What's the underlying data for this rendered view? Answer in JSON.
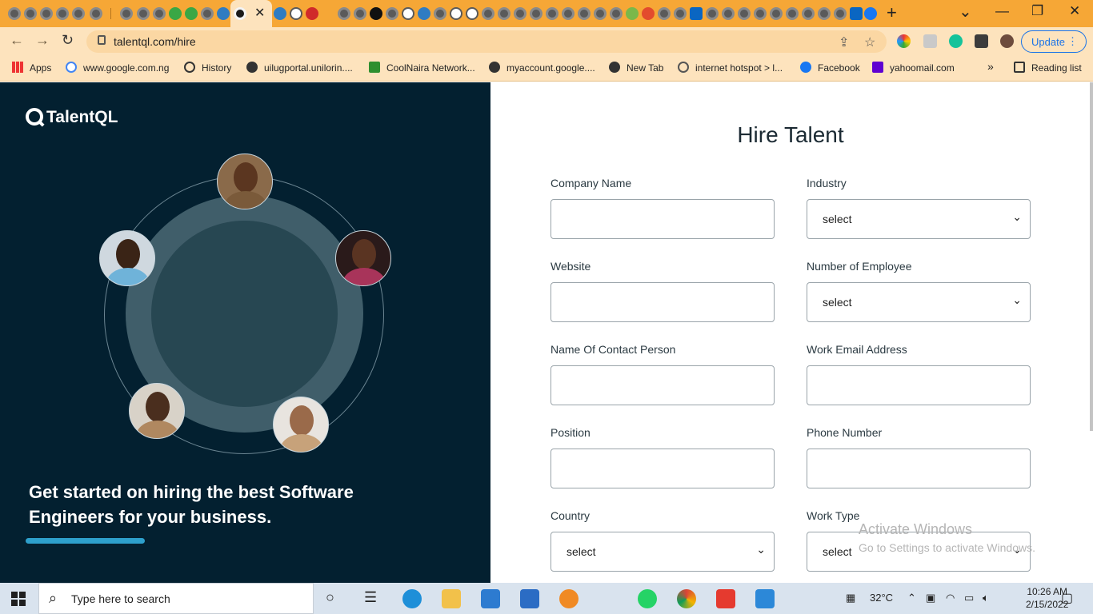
{
  "browser": {
    "active_tab_close": "✕",
    "new_tab": "+",
    "window_controls": {
      "minimize": "—",
      "restore": "❐",
      "close": "✕",
      "tab_search": "⌄"
    },
    "url": "talentql.com/hire",
    "update_label": "Update",
    "menu_dots": "⋮",
    "bookmarks": [
      {
        "label": "Apps",
        "icon": "apps-grid-icon"
      },
      {
        "label": "www.google.com.ng",
        "icon": "google-icon"
      },
      {
        "label": "History",
        "icon": "history-icon"
      },
      {
        "label": "uilugportal.unilorin....",
        "icon": "globe-icon"
      },
      {
        "label": "CoolNaira Network...",
        "icon": "naira-icon"
      },
      {
        "label": "myaccount.google....",
        "icon": "globe-icon"
      },
      {
        "label": "New Tab",
        "icon": "globe-icon"
      },
      {
        "label": "internet hotspot > l...",
        "icon": "hotspot-icon"
      },
      {
        "label": "Facebook",
        "icon": "facebook-icon"
      },
      {
        "label": "yahoomail.com",
        "icon": "yahoo-icon"
      }
    ],
    "bookmarks_overflow": "»",
    "reading_list": "Reading list"
  },
  "hero": {
    "logo_text": "TalentQL",
    "tagline": "Get started on hiring the best Software Engineers for your business."
  },
  "form": {
    "title": "Hire Talent",
    "fields": {
      "company_name": {
        "label": "Company Name",
        "value": ""
      },
      "industry": {
        "label": "Industry",
        "value": "select"
      },
      "website": {
        "label": "Website",
        "value": ""
      },
      "employees": {
        "label": "Number of Employee",
        "value": "select"
      },
      "contact_person": {
        "label": "Name Of Contact Person",
        "value": ""
      },
      "work_email": {
        "label": "Work Email Address",
        "value": ""
      },
      "position": {
        "label": "Position",
        "value": ""
      },
      "phone": {
        "label": "Phone Number",
        "value": ""
      },
      "country": {
        "label": "Country",
        "value": "select"
      },
      "work_type": {
        "label": "Work Type",
        "value": "select"
      }
    },
    "chevron": "⌄"
  },
  "watermark": {
    "line1": "Activate Windows",
    "line2": "Go to Settings to activate Windows."
  },
  "taskbar": {
    "search_placeholder": "Type here to search",
    "temperature": "32°C",
    "time": "10:26 AM",
    "date": "2/15/2022"
  },
  "colors": {
    "tab_strip": "#f6a736",
    "toolbar": "#fde3bd",
    "hero_bg": "#032030",
    "accent_bar": "#2ea0cc",
    "update_blue": "#1a73e8"
  }
}
